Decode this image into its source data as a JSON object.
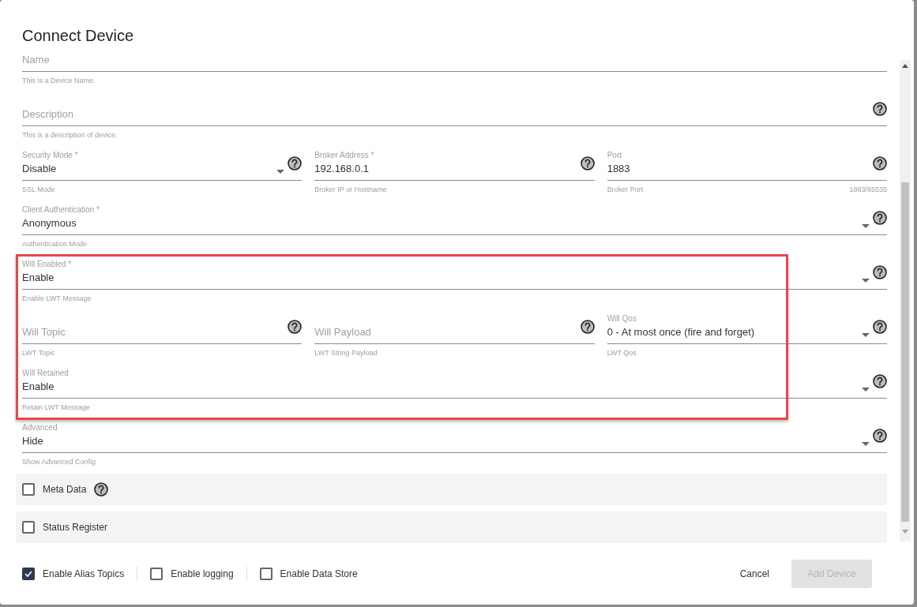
{
  "dialog": {
    "title": "Connect Device"
  },
  "rows": [
    {
      "highlighted": false,
      "fields": [
        {
          "kind": "text",
          "placeholder": "Name",
          "helper": "This is a Device Name.",
          "help": false
        }
      ]
    },
    {
      "highlighted": false,
      "fields": [
        {
          "kind": "text",
          "placeholder": "Description",
          "helper": "This is a description of device.",
          "help": true
        }
      ]
    },
    {
      "highlighted": false,
      "fields": [
        {
          "kind": "select",
          "label": "Security Mode *",
          "value": "Disable",
          "helper": "SSL Mode",
          "help": true
        },
        {
          "kind": "text",
          "label": "Broker Address *",
          "value": "192.168.0.1",
          "helper": "Broker IP or Hostname",
          "help": true
        },
        {
          "kind": "text",
          "label": "Port",
          "value": "1883",
          "helper": "Broker Port",
          "counter": "1883/65535",
          "help": true
        }
      ]
    },
    {
      "highlighted": false,
      "fields": [
        {
          "kind": "select",
          "label": "Client Authentication *",
          "value": "Anonymous",
          "helper": "Authentication Mode",
          "help": true
        }
      ]
    },
    {
      "highlighted": true,
      "fields": [
        {
          "kind": "select",
          "label": "Will Enabled *",
          "value": "Enable",
          "helper": "Enable LWT Message",
          "help": true
        }
      ]
    },
    {
      "highlighted": true,
      "fields": [
        {
          "kind": "text",
          "placeholder": "Will Topic",
          "helper": "LWT Topic",
          "help": true
        },
        {
          "kind": "text",
          "placeholder": "Will Payload",
          "helper": "LWT String Payload",
          "help": true
        },
        {
          "kind": "select",
          "label": "Will Qos",
          "value": "0 - At most once (fire and forget)",
          "helper": "LWT Qos",
          "help": true
        }
      ]
    },
    {
      "highlighted": true,
      "fields": [
        {
          "kind": "select",
          "label": "Will Retained",
          "value": "Enable",
          "helper": "Retain LWT Message",
          "help": true
        }
      ]
    },
    {
      "highlighted": false,
      "fields": [
        {
          "kind": "select",
          "label": "Advanced",
          "value": "Hide",
          "helper": "Show Advanced Config",
          "help": true
        }
      ]
    }
  ],
  "panels": [
    {
      "label": "Meta Data",
      "checked": false,
      "help": true
    },
    {
      "label": "Status Register",
      "checked": false,
      "help": false
    }
  ],
  "footer": {
    "options": [
      {
        "label": "Enable Alias Topics",
        "checked": true
      },
      {
        "label": "Enable logging",
        "checked": false
      },
      {
        "label": "Enable Data Store",
        "checked": false
      }
    ],
    "cancel": "Cancel",
    "submit": {
      "label": "Add Device",
      "disabled": true
    }
  }
}
